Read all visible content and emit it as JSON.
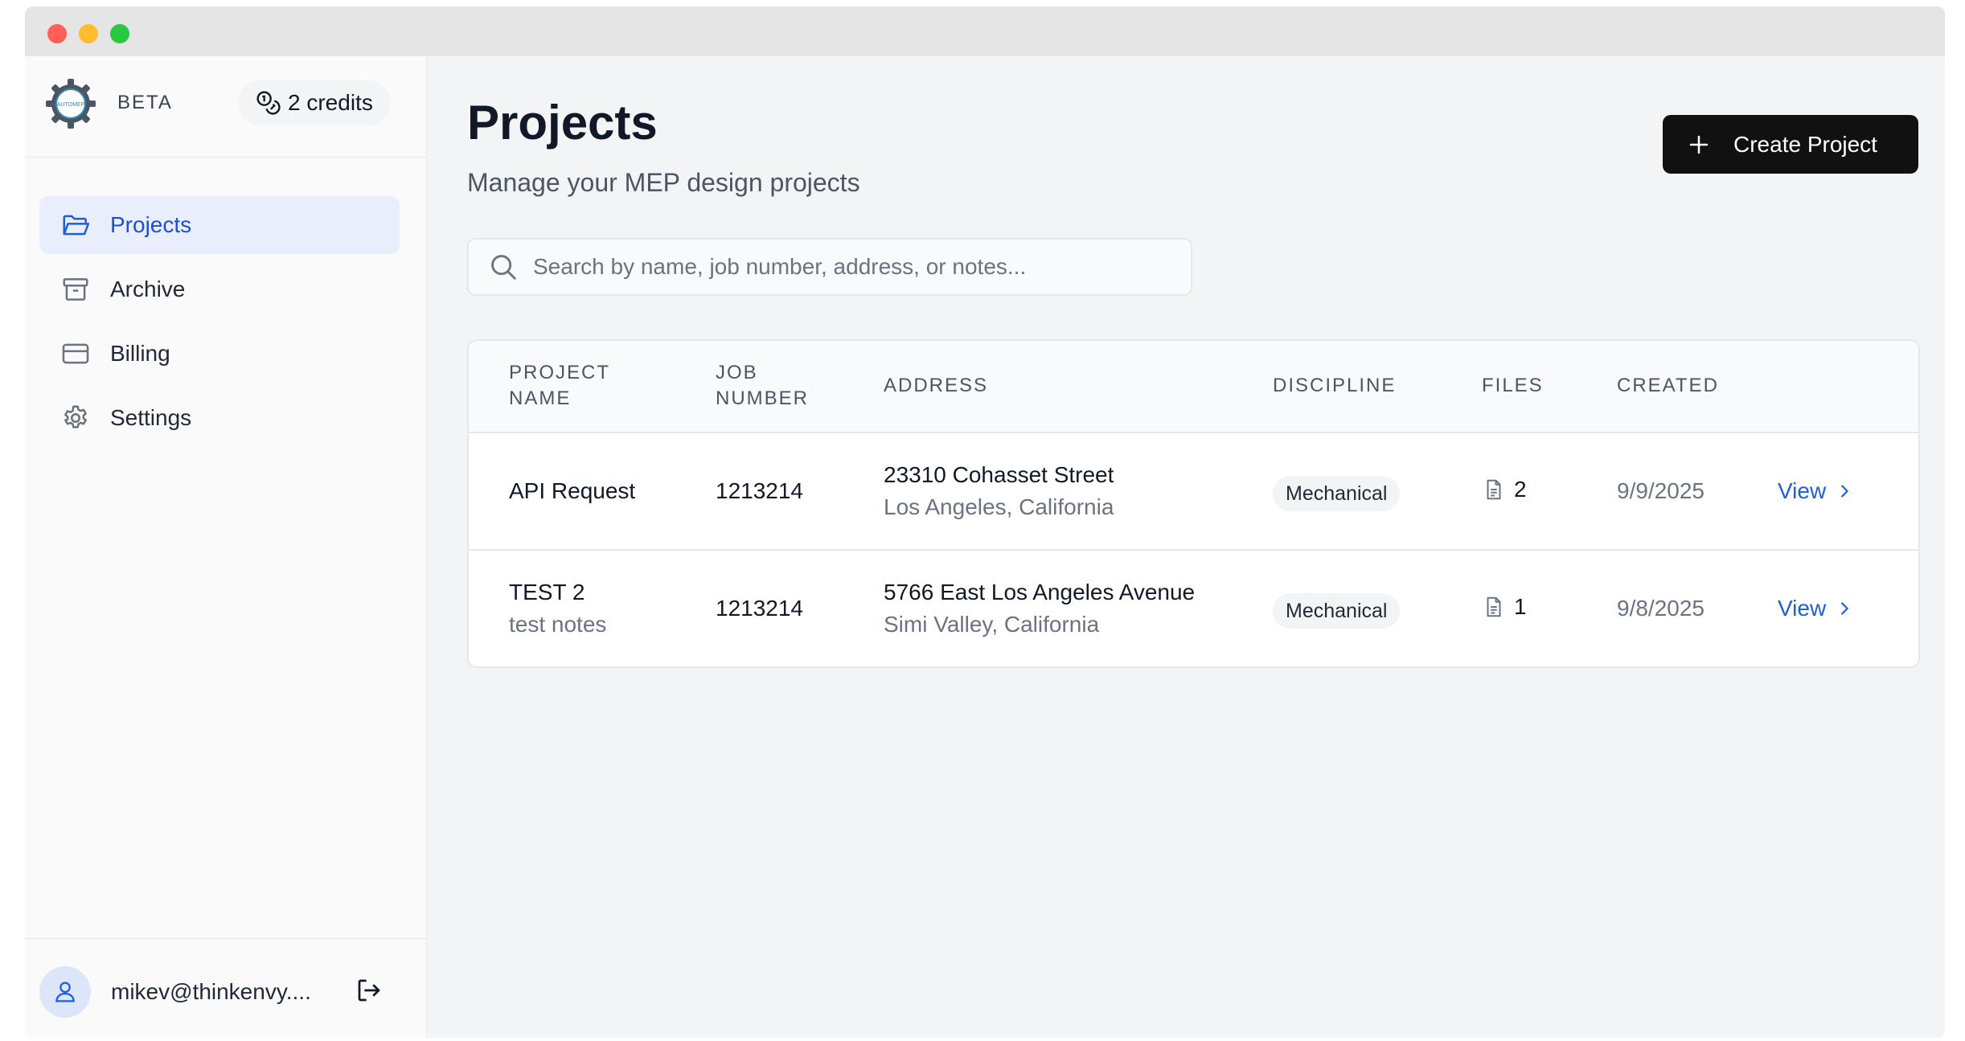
{
  "sidebar": {
    "brand": {
      "logo_text": "AUTOMEP",
      "tag": "BETA"
    },
    "credits": "2 credits",
    "items": [
      {
        "label": "Projects",
        "icon": "folder-open-icon",
        "active": true
      },
      {
        "label": "Archive",
        "icon": "archive-icon",
        "active": false
      },
      {
        "label": "Billing",
        "icon": "credit-card-icon",
        "active": false
      },
      {
        "label": "Settings",
        "icon": "gear-icon",
        "active": false
      }
    ],
    "user": {
      "email": "mikev@thinkenvy...."
    }
  },
  "main": {
    "title": "Projects",
    "subtitle": "Manage your MEP design projects",
    "create_label": "Create Project",
    "search": {
      "placeholder": "Search by name, job number, address, or notes...",
      "value": ""
    }
  },
  "table": {
    "headers": {
      "project_name": [
        "PROJECT",
        "NAME"
      ],
      "job_number": [
        "JOB",
        "NUMBER"
      ],
      "address": "ADDRESS",
      "discipline": "DISCIPLINE",
      "files": "FILES",
      "created": "CREATED"
    },
    "rows": [
      {
        "name": "API Request",
        "notes": "",
        "job_number": "1213214",
        "street": "23310 Cohasset Street",
        "city": "Los Angeles, California",
        "discipline": "Mechanical",
        "files": "2",
        "created": "9/9/2025",
        "action": "View"
      },
      {
        "name": "TEST 2",
        "notes": "test notes",
        "job_number": "1213214",
        "street": "5766 East Los Angeles Avenue",
        "city": "Simi Valley, California",
        "discipline": "Mechanical",
        "files": "1",
        "created": "9/8/2025",
        "action": "View"
      }
    ]
  },
  "colors": {
    "accent": "#1d5fd6",
    "active_nav_bg": "#e8eefc",
    "primary_button": "#111111"
  }
}
